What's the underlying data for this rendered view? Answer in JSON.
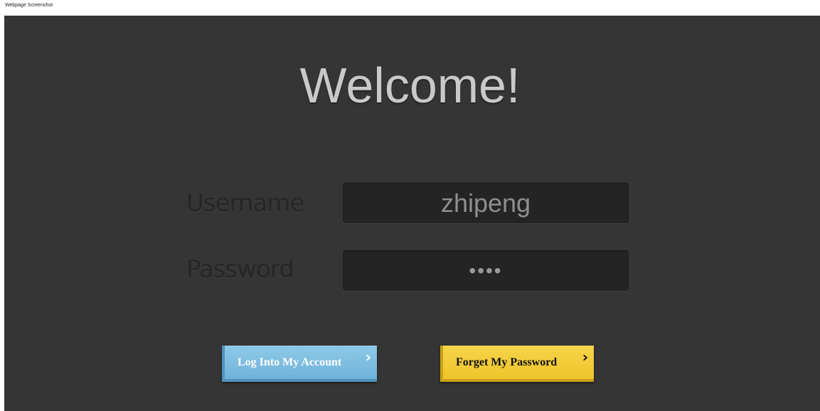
{
  "caption": "Webpage Screenshot",
  "heading": "Welcome!",
  "form": {
    "username_label": "Username",
    "username_value": "zhipeng",
    "password_label": "Password",
    "password_value": "••••"
  },
  "buttons": {
    "login_label": "Log Into My Account",
    "forgot_label": "Forget My Password",
    "chevron_icon": "chevron-right-icon"
  },
  "colors": {
    "panel_bg": "#353535",
    "field_bg": "#242424",
    "login_button": "#7fbfe2",
    "forgot_button": "#f2cc38"
  }
}
